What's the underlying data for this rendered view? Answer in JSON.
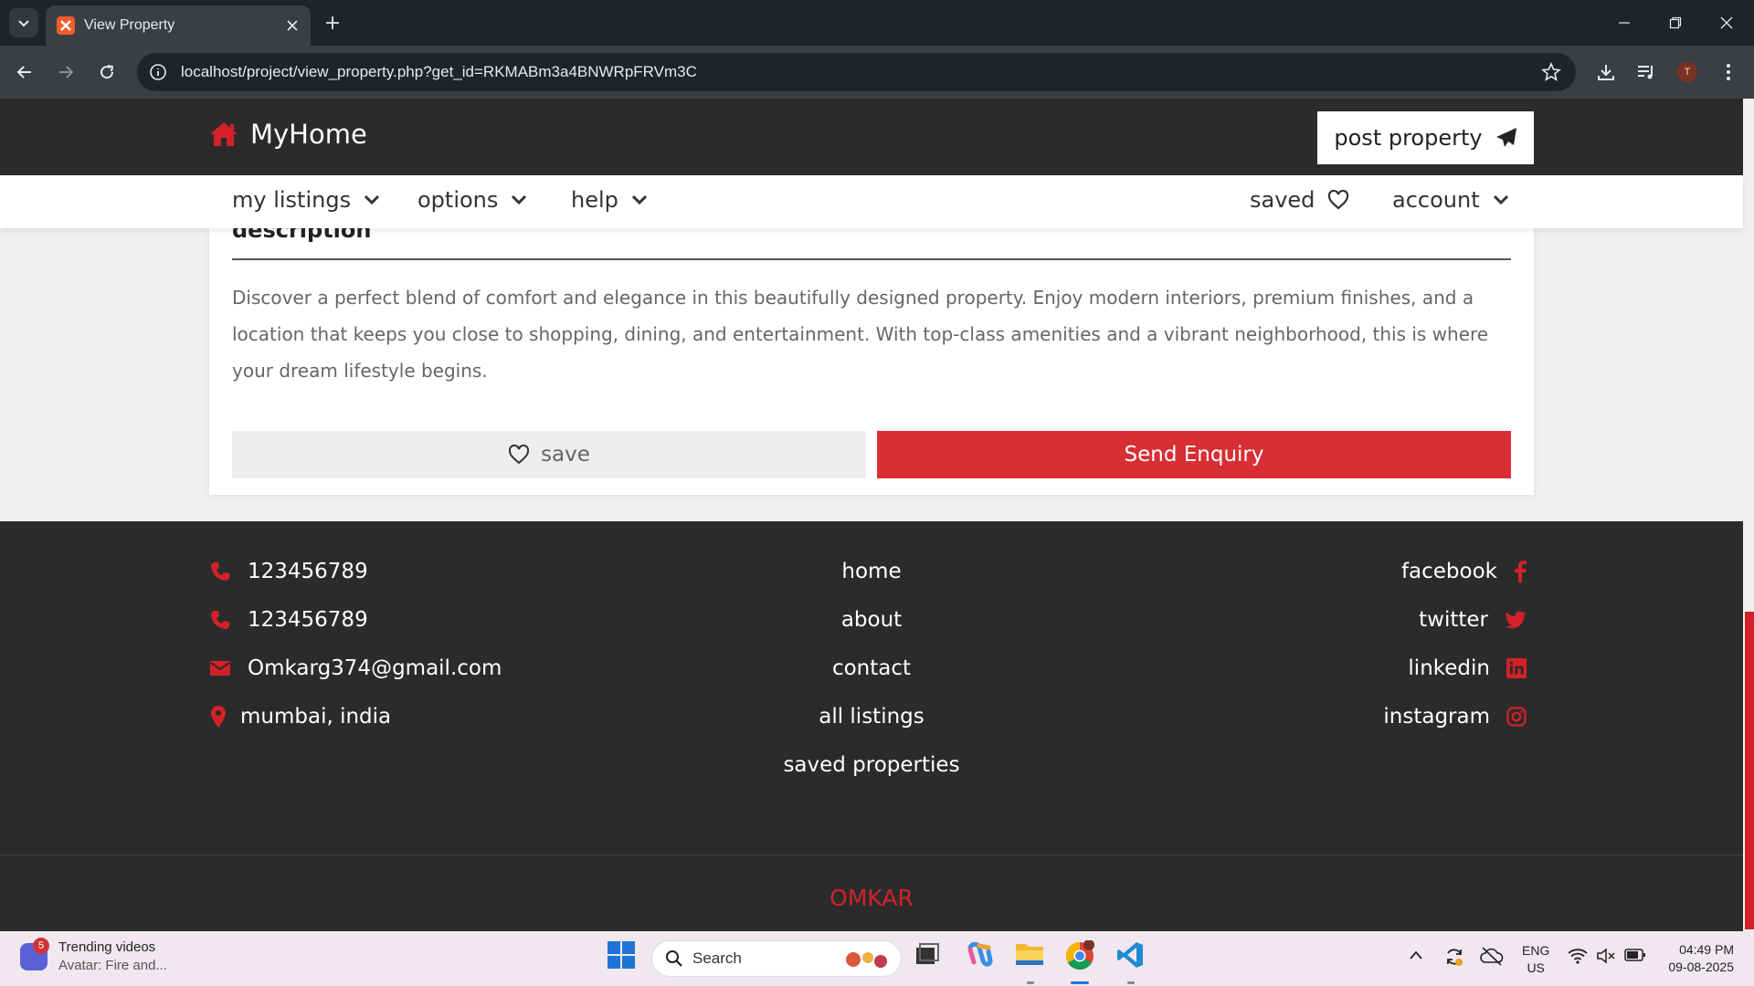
{
  "browser": {
    "tab_title": "View Property",
    "url": "localhost/project/view_property.php?get_id=RKMABm3a4BNWRpFRVm3C",
    "profile_initial": "T"
  },
  "site": {
    "logo": "MyHome",
    "post_property": "post property",
    "nav": {
      "my_listings": "my listings",
      "options": "options",
      "help": "help",
      "saved": "saved",
      "account": "account"
    }
  },
  "property": {
    "description_heading": "description",
    "description": "Discover a perfect blend of comfort and elegance in this beautifully designed property. Enjoy modern interiors, premium finishes, and a location that keeps you close to shopping, dining, and entertainment. With top-class amenities and a vibrant neighborhood, this is where your dream lifestyle begins.",
    "save_label": "save",
    "enquiry_label": "Send Enquiry"
  },
  "footer": {
    "contacts": [
      {
        "icon": "phone-icon",
        "text": "123456789"
      },
      {
        "icon": "phone-icon",
        "text": "123456789"
      },
      {
        "icon": "envelope-icon",
        "text": "Omkarg374@gmail.com"
      },
      {
        "icon": "map-marker-icon",
        "text": "mumbai, india"
      }
    ],
    "links": [
      "home",
      "about",
      "contact",
      "all listings",
      "saved properties"
    ],
    "social": [
      {
        "icon": "facebook-icon",
        "text": "facebook"
      },
      {
        "icon": "twitter-icon",
        "text": "twitter"
      },
      {
        "icon": "linkedin-icon",
        "text": "linkedin"
      },
      {
        "icon": "instagram-icon",
        "text": "instagram"
      }
    ],
    "credit": "OMKAR"
  },
  "taskbar": {
    "widget_badge": "5",
    "widget_title": "Trending videos",
    "widget_subtitle": "Avatar: Fire and...",
    "search_placeholder": "Search",
    "lang_top": "ENG",
    "lang_bottom": "US",
    "time": "04:49 PM",
    "date": "09-08-2025"
  },
  "colors": {
    "accent": "#d42128",
    "header_bg": "#2b2b2b",
    "enquiry_bg": "#d82e35"
  }
}
